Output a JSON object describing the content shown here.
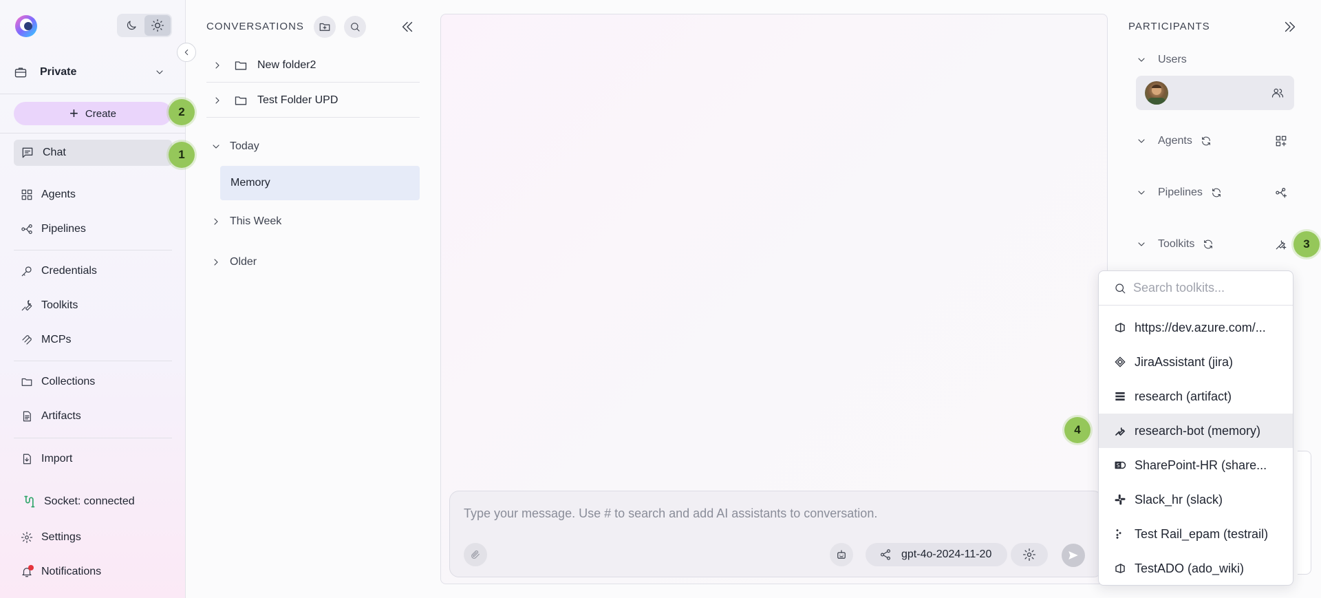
{
  "sidebar": {
    "project": "Private",
    "create_label": "Create",
    "nav": {
      "chat": "Chat",
      "agents": "Agents",
      "pipelines": "Pipelines",
      "credentials": "Credentials",
      "toolkits": "Toolkits",
      "mcps": "MCPs",
      "collections": "Collections",
      "artifacts": "Artifacts",
      "import": "Import",
      "socket": "Socket: connected",
      "settings": "Settings",
      "notifications": "Notifications"
    }
  },
  "badges": {
    "b1": "1",
    "b2": "2",
    "b3": "3",
    "b4": "4"
  },
  "conversations": {
    "title": "CONVERSATIONS",
    "folders": [
      "New folder2",
      "Test Folder UPD"
    ],
    "groups": {
      "today": "Today",
      "week": "This Week",
      "older": "Older"
    },
    "today_items": [
      "Memory"
    ]
  },
  "chat": {
    "input_placeholder": "Type your message. Use # to search and add AI assistants to conversation.",
    "model": "gpt-4o-2024-11-20"
  },
  "participants": {
    "title": "PARTICIPANTS",
    "sections": {
      "users": "Users",
      "agents": "Agents",
      "pipelines": "Pipelines",
      "toolkits": "Toolkits"
    }
  },
  "toolkit_dropdown": {
    "placeholder": "Search toolkits...",
    "items": [
      "https://dev.azure.com/...",
      "JiraAssistant (jira)",
      "research (artifact)",
      "research-bot (memory)",
      "SharePoint-HR (share...",
      "Slack_hr (slack)",
      "Test Rail_epam (testrail)",
      "TestADO (ado_wiki)"
    ],
    "highlighted_index": 3
  },
  "colors": {
    "accent_create": "#ead5fb",
    "badge": "#95c75a",
    "selected_conv": "#e6ebf8"
  }
}
